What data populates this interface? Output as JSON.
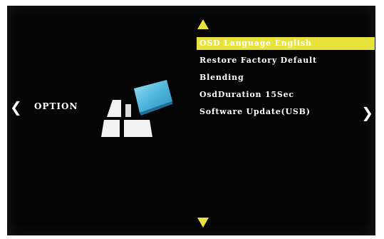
{
  "screen": {
    "category": {
      "label": "OPTION",
      "prev_icon": "chevron-left-icon",
      "next_icon": "chevron-right-icon"
    },
    "logo_icon": "option-category-icon",
    "scroll": {
      "up_icon": "triangle-up-icon",
      "down_icon": "triangle-down-icon"
    },
    "menu": {
      "items": [
        {
          "label": "OSD Language English",
          "selected": true
        },
        {
          "label": "Restore Factory Default",
          "selected": false
        },
        {
          "label": "Blending",
          "selected": false
        },
        {
          "label": "OsdDuration 15Sec",
          "selected": false
        },
        {
          "label": "Software Update(USB)",
          "selected": false
        }
      ]
    },
    "colors": {
      "highlight": "#e8e33a",
      "arrow": "#e8e33a",
      "background": "#050505",
      "text": "#ffffff",
      "logo_accent": "#4fb6dc"
    }
  }
}
